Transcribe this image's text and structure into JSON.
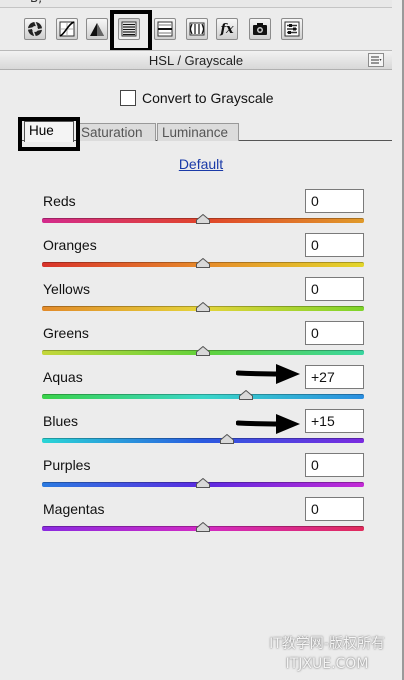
{
  "top_strip": {
    "cut_text": "B,"
  },
  "toolbar": {
    "tools": [
      {
        "name": "basic-icon",
        "label": "Basic"
      },
      {
        "name": "tone-curve-icon",
        "label": "Tone Curve"
      },
      {
        "name": "detail-icon",
        "label": "Detail"
      },
      {
        "name": "hsl-grayscale-icon",
        "label": "HSL / Grayscale"
      },
      {
        "name": "split-toning-icon",
        "label": "Split Toning"
      },
      {
        "name": "lens-corrections-icon",
        "label": "Lens Corrections"
      },
      {
        "name": "fx-icon",
        "label": "fx"
      },
      {
        "name": "camera-calibration-icon",
        "label": "Camera Calibration"
      },
      {
        "name": "presets-icon",
        "label": "Presets"
      }
    ],
    "selected_index": 3,
    "fx_text": "fx"
  },
  "panel": {
    "title": "HSL / Grayscale",
    "menu_icon": "panel-menu-icon"
  },
  "grayscale": {
    "label": "Convert to Grayscale",
    "checked": false
  },
  "tabs": [
    {
      "label": "Hue",
      "active": true
    },
    {
      "label": "Saturation",
      "active": false
    },
    {
      "label": "Luminance",
      "active": false
    }
  ],
  "default_link": "Default",
  "sliders": [
    {
      "label": "Reds",
      "value": "0",
      "level": 0.5,
      "gradient": [
        "#d32a8c",
        "#e0442a",
        "#e09a2a"
      ]
    },
    {
      "label": "Oranges",
      "value": "0",
      "level": 0.5,
      "gradient": [
        "#d8322a",
        "#e68a2a",
        "#e3d62a"
      ]
    },
    {
      "label": "Yellows",
      "value": "0",
      "level": 0.5,
      "gradient": [
        "#e28a2a",
        "#e4d43a",
        "#7dd42a"
      ]
    },
    {
      "label": "Greens",
      "value": "0",
      "level": 0.5,
      "gradient": [
        "#c4d63a",
        "#62d23a",
        "#3ad6a0"
      ]
    },
    {
      "label": "Aquas",
      "value": "+27",
      "level": 0.635,
      "gradient": [
        "#3ad24a",
        "#3ad6c8",
        "#2a8ee0"
      ]
    },
    {
      "label": "Blues",
      "value": "+15",
      "level": 0.575,
      "gradient": [
        "#2ad6d6",
        "#2a5ae0",
        "#7a2ae0"
      ]
    },
    {
      "label": "Purples",
      "value": "0",
      "level": 0.5,
      "gradient": [
        "#2a7ae0",
        "#5a2ae0",
        "#c42ad6"
      ]
    },
    {
      "label": "Magentas",
      "value": "0",
      "level": 0.5,
      "gradient": [
        "#8a2ae0",
        "#d22ac4",
        "#e02a5a"
      ]
    }
  ],
  "arrows": [
    {
      "points_to": "Aquas"
    },
    {
      "points_to": "Blues"
    }
  ],
  "watermark": {
    "line1": "IT教学网-版权所有",
    "line2": "ITJXUE.COM"
  }
}
